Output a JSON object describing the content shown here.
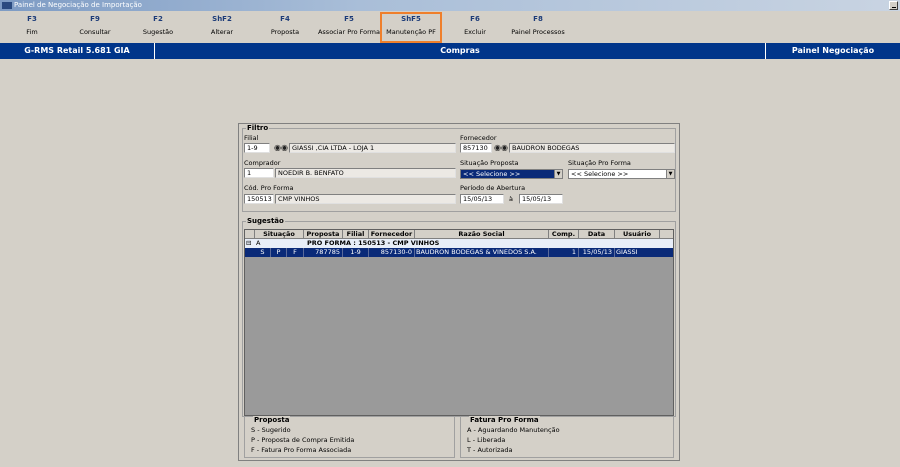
{
  "window": {
    "title": "Painel de Negociação de Importação"
  },
  "toolbar": [
    {
      "key": "F3",
      "label": "Fim"
    },
    {
      "key": "F9",
      "label": "Consultar"
    },
    {
      "key": "F2",
      "label": "Sugestão"
    },
    {
      "key": "ShF2",
      "label": "Alterar"
    },
    {
      "key": "F4",
      "label": "Proposta"
    },
    {
      "key": "F5",
      "label": "Associar Pro Forma"
    },
    {
      "key": "ShF5",
      "label": "Manutenção PF"
    },
    {
      "key": "F6",
      "label": "Excluir"
    },
    {
      "key": "F8",
      "label": "Painel Processos"
    }
  ],
  "status": {
    "left": "G-RMS Retail 5.681 GIA",
    "center": "Compras",
    "right": "Painel Negociação"
  },
  "filtro": {
    "title": "Filtro",
    "filial_label": "Filial",
    "filial_code": "1-9",
    "filial_name": "GIASSI ,CIA LTDA - LOJA 1",
    "fornecedor_label": "Fornecedor",
    "fornecedor_code": "857130",
    "fornecedor_name": "BAUDRON BODEGAS",
    "comprador_label": "Comprador",
    "comprador_code": "1",
    "comprador_name": "NOEDIR B. BENFATO",
    "situacao_proposta_label": "Situação Proposta",
    "situacao_proposta_value": "<< Selecione >>",
    "situacao_pf_label": "Situação Pro Forma",
    "situacao_pf_value": "<< Selecione >>",
    "cod_pf_label": "Cód. Pro Forma",
    "cod_pf_code": "150513",
    "cod_pf_name": "CMP VINHOS",
    "periodo_label": "Período de Abertura",
    "periodo_de": "15/05/13",
    "periodo_sep": "à",
    "periodo_ate": "15/05/13"
  },
  "sugestao": {
    "title": "Sugestão",
    "columns": [
      "Situação",
      "Proposta",
      "Filial",
      "Fornecedor",
      "Razão Social",
      "Comp.",
      "Data",
      "Usuário"
    ],
    "group": {
      "toggle": "⊟",
      "code": "A",
      "label": "PRO FORMA : 150513 - CMP VINHOS"
    },
    "row": {
      "s": "S",
      "p": "P",
      "f": "F",
      "proposta": "787785",
      "filial": "1-9",
      "fornecedor": "857130-0",
      "razao": "BAUDRON BODEGAS & VINEDOS S.A.",
      "comp": "1",
      "data": "15/05/13",
      "usuario": "GIASSI"
    }
  },
  "legend_proposta": {
    "title": "Proposta",
    "items": [
      "S - Sugerido",
      "P - Proposta de Compra Emitida",
      "F - Fatura Pro Forma Associada"
    ]
  },
  "legend_fatura": {
    "title": "Fatura Pro Forma",
    "items": [
      "A - Aguardando Manutenção",
      "L - Liberada",
      "T - Autorizada"
    ]
  }
}
